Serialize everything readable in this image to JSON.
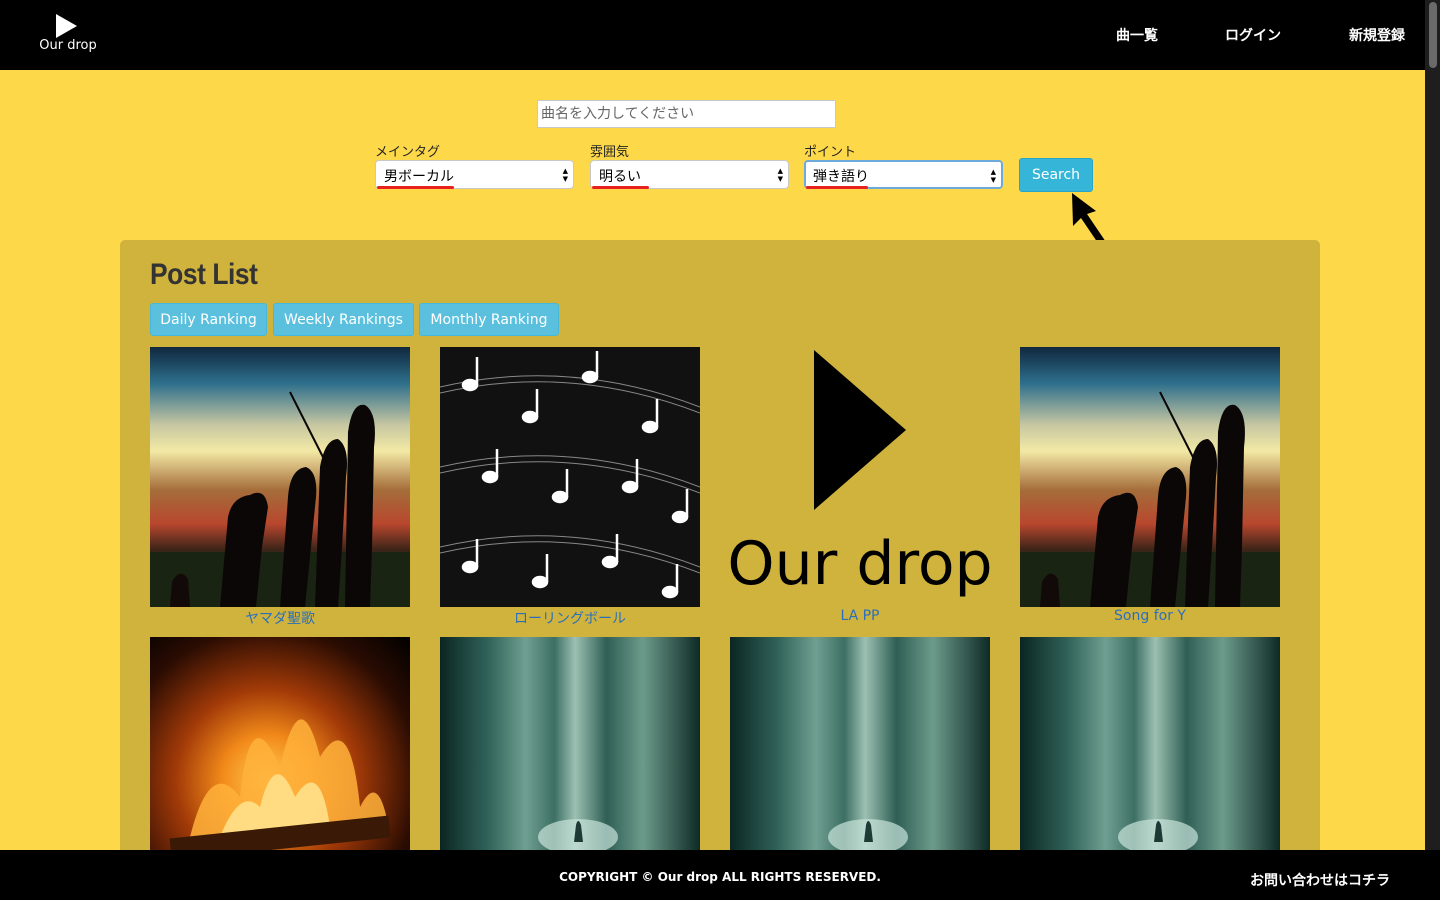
{
  "header": {
    "logo_text": "Our drop",
    "nav": [
      "曲一覧",
      "ログイン",
      "新規登録"
    ]
  },
  "search": {
    "placeholder": "曲名を入力してください",
    "filters": [
      {
        "label": "メインタグ",
        "value": "男ボーカル"
      },
      {
        "label": "雰囲気",
        "value": "明るい"
      },
      {
        "label": "ポイント",
        "value": "弾き語り"
      }
    ],
    "button_label": "Search"
  },
  "post_list": {
    "title": "Post List",
    "ranking_buttons": [
      "Daily Ranking",
      "Weekly Rankings",
      "Monthly Ranking"
    ],
    "posts": [
      {
        "title": "ヤマダ聖歌",
        "image": "sunset-silhouettes"
      },
      {
        "title": "ローリングボール",
        "image": "music-notes"
      },
      {
        "title": "LA PP",
        "image": "our-drop-logo"
      },
      {
        "title": "Song for Y",
        "image": "sunset-silhouettes"
      },
      {
        "title": "",
        "image": "campfire"
      },
      {
        "title": "",
        "image": "misty-forest"
      },
      {
        "title": "",
        "image": "misty-forest"
      },
      {
        "title": "",
        "image": "misty-forest"
      }
    ],
    "logo_image_text": "Our drop"
  },
  "footer": {
    "copyright": "COPYRIGHT © Our drop ALL RIGHTS RESERVED.",
    "contact": "お問い合わせはコチラ"
  },
  "colors": {
    "page_background": "#fdd94a",
    "panel_background": "#d0b33c",
    "header_background": "#000000",
    "button_blue": "#5bc0de",
    "link_blue": "#2b6fba",
    "underline_red": "#e8201e"
  }
}
